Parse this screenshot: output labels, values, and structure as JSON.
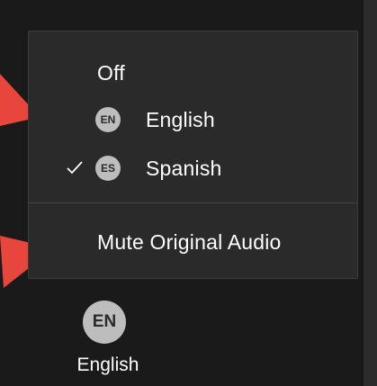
{
  "menu": {
    "items": [
      {
        "label": "Off"
      },
      {
        "label": "English",
        "badge": "EN"
      },
      {
        "label": "Spanish",
        "badge": "ES",
        "checked": true
      }
    ],
    "mute_label": "Mute Original Audio"
  },
  "toolbar_button": {
    "badge": "EN",
    "label": "English"
  },
  "colors": {
    "background": "#1a1a1a",
    "menu_background": "#2a2a2a",
    "badge": "#bdbdbd",
    "arrow": "#e8453c",
    "text": "#ffffff"
  }
}
